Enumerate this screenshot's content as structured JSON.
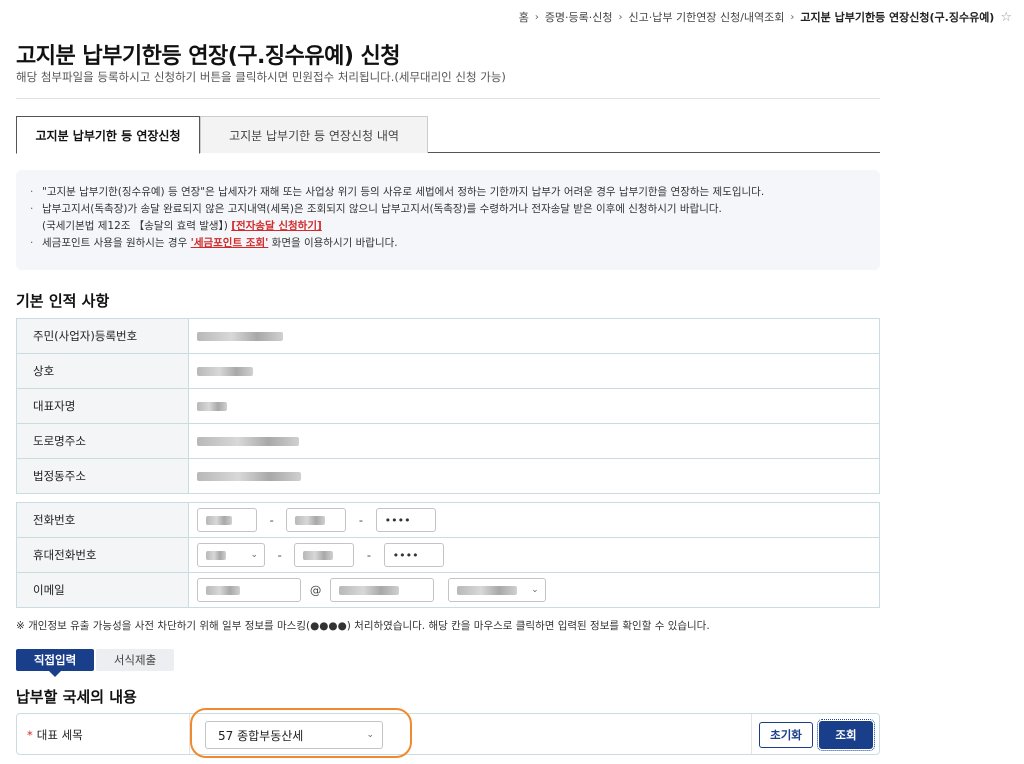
{
  "breadcrumb": {
    "items": [
      "홈",
      "증명·등록·신청",
      "신고·납부 기한연장 신청/내역조회",
      "고지분 납부기한등 연장신청(구.징수유예)"
    ],
    "sep": "›",
    "star": "☆"
  },
  "header": {
    "title": "고지분 납부기한등 연장(구.징수유예) 신청",
    "description": "해당 첨부파일을 등록하시고 신청하기 버튼을 클릭하시면 민원접수 처리됩니다.(세무대리인 신청 가능)"
  },
  "tabs": [
    {
      "label": "고지분 납부기한 등 연장신청",
      "active": true
    },
    {
      "label": "고지분 납부기한 등 연장신청 내역",
      "active": false
    }
  ],
  "notice": {
    "line1": "\"고지분 납부기한(징수유예) 등 연장\"은 납세자가 재해 또는 사업상 위기 등의 사유로 세법에서 정하는 기한까지 납부가 어려운 경우 납부기한을 연장하는 제도입니다.",
    "line2": "납부고지서(독촉장)가 송달 완료되지 않은 고지내역(세목)은 조회되지 않으니 납부고지서(독촉장)를 수령하거나 전자송달 받은 이후에 신청하시기 바랍니다.",
    "line3_text": "(국세기본법 제12조 【송달의 효력 발생】)",
    "line3_link": "[전자송달 신청하기]",
    "line4_pre": "세금포인트 사용을 원하시는 경우",
    "line4_link": "'세금포인트 조회'",
    "line4_post": "화면을 이용하시기 바랍니다."
  },
  "basic": {
    "title": "기본 인적 사항",
    "labels": {
      "id": "주민(사업자)등록번호",
      "name": "상호",
      "rep": "대표자명",
      "road": "도로명주소",
      "legal": "법정동주소",
      "phone": "전화번호",
      "mobile": "휴대전화번호",
      "email": "이메일"
    },
    "phone_third": "••••",
    "mobile_third": "••••",
    "at": "@"
  },
  "privacy_note": "※ 개인정보 유출 가능성을 사전 차단하기 위해 일부 정보를 마스킹(●●●●) 처리하였습니다. 해당 칸을 마우스로 클릭하면 입력된 정보를 확인할 수 있습니다.",
  "input_mode": {
    "direct": "직접입력",
    "form": "서식제출"
  },
  "tax": {
    "title": "납부할 국세의 내용",
    "label": "대표 세목",
    "required_mark": "*",
    "selected": "57 종합부동산세",
    "reset": "초기화",
    "search": "조회"
  },
  "colors": {
    "primary": "#1a3f8a",
    "highlight": "#f08a2e",
    "alert": "#d12a2a"
  }
}
